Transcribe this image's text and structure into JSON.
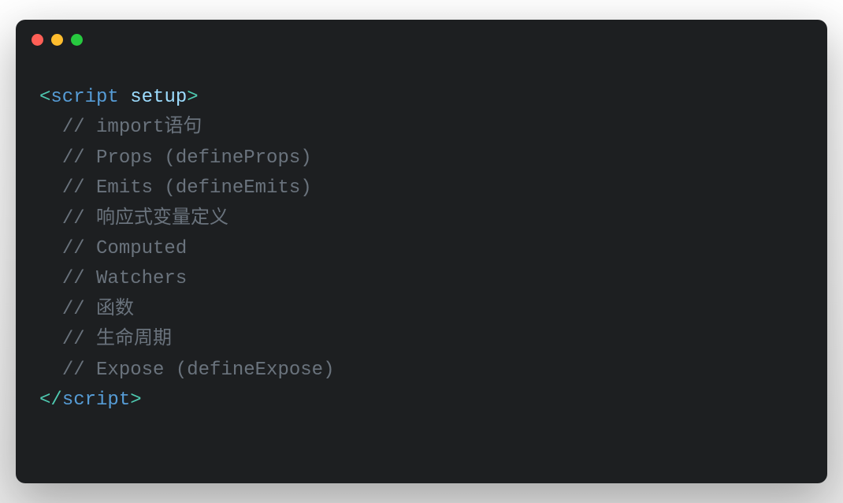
{
  "titlebar": {
    "traffic_lights": [
      "close",
      "minimize",
      "maximize"
    ]
  },
  "code": {
    "open_tag": {
      "bracket_open": "<",
      "name": "script",
      "space": " ",
      "attr": "setup",
      "bracket_close": ">"
    },
    "comments": [
      "// import语句",
      "// Props (defineProps)",
      "// Emits (defineEmits)",
      "// 响应式变量定义",
      "// Computed",
      "// Watchers",
      "// 函数",
      "// 生命周期",
      "// Expose (defineExpose)"
    ],
    "close_tag": {
      "bracket_open": "</",
      "name": "script",
      "bracket_close": ">"
    },
    "indent": "  "
  },
  "colors": {
    "background": "#1d1f21",
    "tag_bracket": "#4ec9b0",
    "tag_name": "#569cd6",
    "tag_attr": "#9cdcfe",
    "comment": "#6a737d",
    "close": "#ff5f56",
    "minimize": "#ffbd2e",
    "maximize": "#27c93f"
  }
}
